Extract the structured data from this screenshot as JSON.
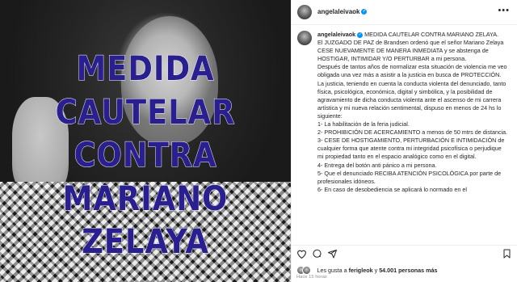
{
  "post_image": {
    "headline_lines": [
      "MEDIDA",
      "CAUTELAR",
      "CONTRA",
      "MARIANO",
      "ZELAYA"
    ],
    "headline_color": "#2a1f8f"
  },
  "header": {
    "username": "angelaleivaok",
    "more_icon": "more-dots-icon"
  },
  "caption": {
    "username": "angelaleivaok",
    "paragraphs": [
      "MEDIDA CAUTELAR CONTRA MARIANO ZELAYA.",
      "El JUZGADO DE PAZ de Brandsen ordenó que el señor Mariano Zelaya CESE NUEVAMENTE DE MANERA INMEDIATA y se abstenga de HOSTIGAR, INTIMIDAR Y/O PERTURBAR a mi persona.",
      "Después de tantos años de normalizar esta situación de violencia me veo obligada una vez más a asistir a la justicia en busca de PROTECCIÓN.",
      "La justicia, teniendo en cuenta la conducta violenta del denunciado, tanto física, psicológica, económica, digital y simbólica, y la posibilidad de agravamiento de dicha conducta violenta ante el ascenso de mi carrera artística y mi nueva relación sentimental, dispuso en menos de 24 hs lo siguiente:",
      "1- La habilitación de la feria judicial.",
      "2- PROHIBICIÓN DE ACERCAMIENTO a menos de 50 mtrs de distancia.",
      "3- CESE DE HOSTIGAMIENTO, PERTURBACIÓN E INTIMIDACIÓN de cualquier forma que atente contra mi integridad psicofísica o perjudique mi propiedad tanto en el espacio analógico como en el digital.",
      "4- Entrega del botón anti pánico a mi persona.",
      "5- Que el denunciado RECIBA ATENCIÓN PSICOLÓGICA por parte de profesionales idóneos.",
      "6- En caso de desobediencia se aplicará lo normado en el"
    ]
  },
  "actions": {
    "like_icon": "heart-icon",
    "comment_icon": "comment-icon",
    "share_icon": "share-icon",
    "save_icon": "bookmark-icon"
  },
  "likes": {
    "prefix": "Les gusta a ",
    "first_user": "ferigleok",
    "middle": " y ",
    "count": "54.001 personas más"
  },
  "timestamp": "Hace 15 horas"
}
